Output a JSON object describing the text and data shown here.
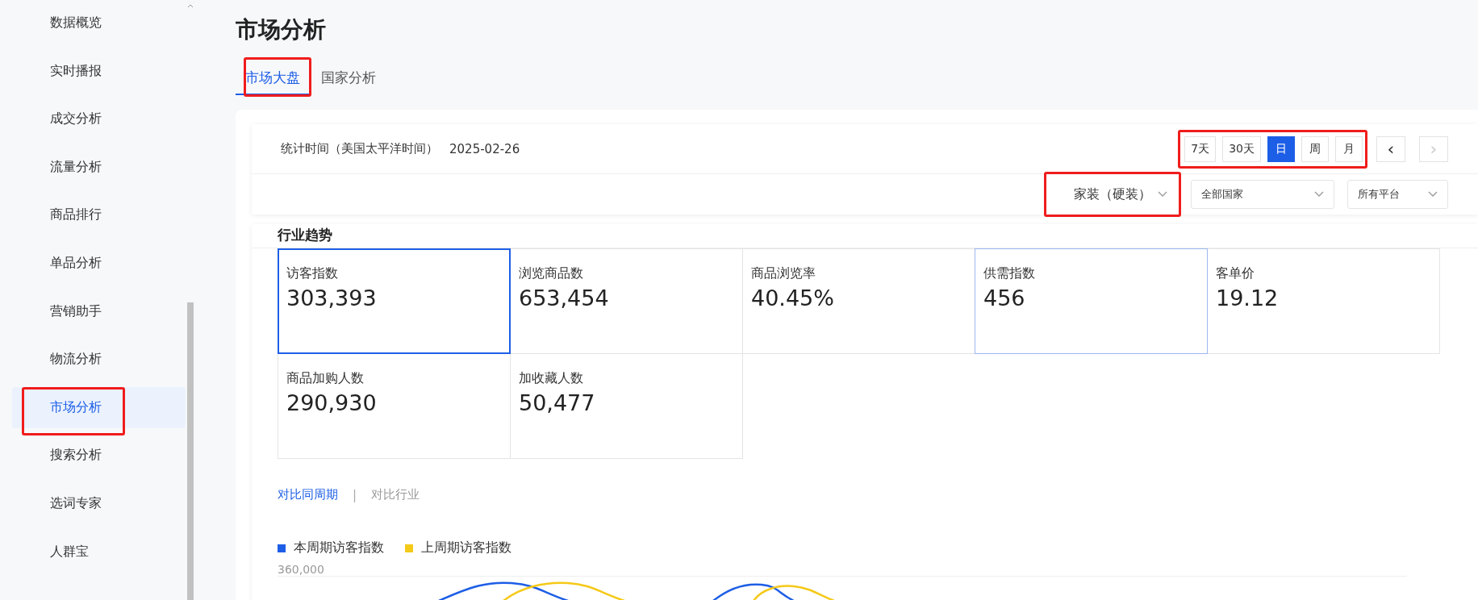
{
  "sidebar": {
    "items": [
      {
        "label": "数据概览",
        "selected": false
      },
      {
        "label": "实时播报",
        "selected": false
      },
      {
        "label": "成交分析",
        "selected": false
      },
      {
        "label": "流量分析",
        "selected": false
      },
      {
        "label": "商品排行",
        "selected": false
      },
      {
        "label": "单品分析",
        "selected": false
      },
      {
        "label": "营销助手",
        "selected": false
      },
      {
        "label": "物流分析",
        "selected": false
      },
      {
        "label": "市场分析",
        "selected": true,
        "annotated": true
      },
      {
        "label": "搜索分析",
        "selected": false
      },
      {
        "label": "选词专家",
        "selected": false
      },
      {
        "label": "人群宝",
        "selected": false
      }
    ]
  },
  "page": {
    "title": "市场分析"
  },
  "tabs": [
    {
      "label": "市场大盘",
      "selected": true,
      "annotated": true
    },
    {
      "label": "国家分析",
      "selected": false
    }
  ],
  "filters": {
    "date_label": "统计时间（美国太平洋时间）",
    "date": "2025-02-26",
    "periods": {
      "annotated": true,
      "items": [
        {
          "label": "7天",
          "selected": false
        },
        {
          "label": "30天",
          "selected": false
        },
        {
          "label": "日",
          "selected": true
        },
        {
          "label": "周",
          "selected": false
        },
        {
          "label": "月",
          "selected": false
        }
      ]
    },
    "prev": {
      "label": "‹",
      "disabled": false
    },
    "next": {
      "label": "›",
      "disabled": true
    },
    "dropdowns": [
      {
        "value": "家装（硬装）",
        "annotated": true
      },
      {
        "value": "全部国家"
      },
      {
        "value": "所有平台"
      }
    ]
  },
  "trend": {
    "title": "行业趋势",
    "metrics": [
      {
        "label": "访客指数",
        "value": "303,393",
        "selected": true,
        "hovered": false
      },
      {
        "label": "浏览商品数",
        "value": "653,454",
        "selected": false,
        "hovered": false
      },
      {
        "label": "商品浏览率",
        "value": "40.45%",
        "selected": false,
        "hovered": false
      },
      {
        "label": "供需指数",
        "value": "456",
        "selected": false,
        "hovered": true
      },
      {
        "label": "客单价",
        "value": "19.12",
        "selected": false,
        "hovered": false
      },
      {
        "label": "商品加购人数",
        "value": "290,930",
        "selected": false,
        "hovered": false
      },
      {
        "label": "加收藏人数",
        "value": "50,477",
        "selected": false,
        "hovered": false
      }
    ],
    "compare": [
      {
        "label": "对比同周期",
        "selected": true
      },
      {
        "label": "|",
        "kind": "separator"
      },
      {
        "label": "对比行业",
        "selected": false
      }
    ],
    "legend": [
      {
        "label": "本周期访客指数",
        "color": "#1d5ee6"
      },
      {
        "label": "上周期访客指数",
        "color": "#f5c918"
      }
    ],
    "y_tick": "360,000"
  }
}
